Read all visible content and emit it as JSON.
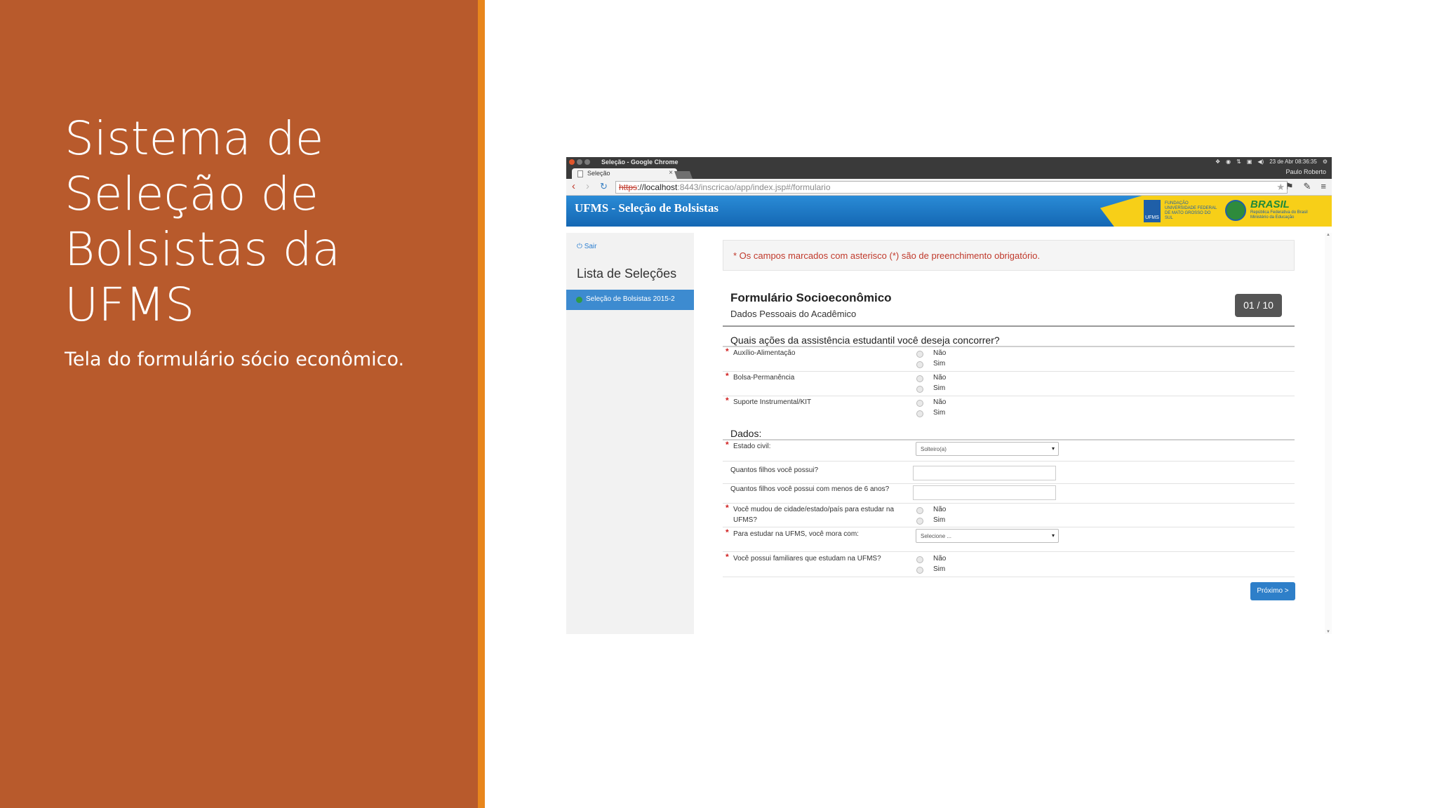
{
  "slide": {
    "title": "Sistema de Seleção de Bolsistas da UFMS",
    "subtitle": "Tela do formulário sócio econômico.",
    "colors": {
      "panel": "#b85a2c",
      "accent_bar": "#e8861c"
    }
  },
  "browser": {
    "window_title": "Seleção - Google Chrome",
    "tab_title": "Seleção",
    "tab_close": "×",
    "clock": "23 de Abr 08:36:35",
    "user": "Paulo Roberto",
    "url_scheme": "https",
    "url_host": "://localhost",
    "url_rest": ":8443/inscricao/app/index.jsp#/formulario",
    "icons": [
      "back-arrow-icon",
      "forward-arrow-icon",
      "reload-icon",
      "bookmark-star-icon",
      "extension-icon",
      "tools-icon",
      "menu-icon"
    ]
  },
  "app": {
    "title": "UFMS - Seleção de Bolsistas",
    "logos": {
      "ufms": "UFMS",
      "fundacao": "FUNDAÇÃO UNIVERSIDADE FEDERAL DE MATO GROSSO DO SUL",
      "brasil": "BRASIL",
      "republica": "República Federativa do Brasil Ministério da Educação"
    },
    "colors": {
      "header_blue": "#1467b3",
      "header_yellow": "#f7cf18"
    }
  },
  "sidebar": {
    "logout": "Sair",
    "list_title": "Lista de Seleções",
    "items": [
      {
        "label": "Seleção de Bolsistas 2015-2",
        "active": true
      }
    ]
  },
  "form": {
    "required_notice": "* Os campos marcados com asterisco (*) são de preenchimento obrigatório.",
    "title": "Formulário Socioeconômico",
    "subtitle": "Dados Pessoais do Acadêmico",
    "step": "01 / 10",
    "section_assistencia": "Quais ações da assistência estudantil você deseja concorrer?",
    "assistencia": [
      {
        "label": "Auxílio-Alimentação",
        "options": [
          "Não",
          "Sim"
        ]
      },
      {
        "label": "Bolsa-Permanência",
        "options": [
          "Não",
          "Sim"
        ]
      },
      {
        "label": "Suporte Instrumental/KIT",
        "options": [
          "Não",
          "Sim"
        ]
      }
    ],
    "section_dados": "Dados:",
    "estado_civil": {
      "label": "Estado civil:",
      "value": "Solteiro(a)"
    },
    "filhos": {
      "label": "Quantos filhos você possui?",
      "value": ""
    },
    "filhos6": {
      "label": "Quantos filhos você possui com menos de 6 anos?",
      "value": ""
    },
    "mudou": {
      "label": "Você mudou de cidade/estado/país para estudar na UFMS?",
      "options": [
        "Não",
        "Sim"
      ]
    },
    "mora": {
      "label": "Para estudar na UFMS, você mora com:",
      "value": "Selecione ..."
    },
    "familiares": {
      "label": "Você possui familiares que estudam na UFMS?",
      "options": [
        "Não",
        "Sim"
      ]
    },
    "next_button": "Próximo >",
    "select_caret": "▾"
  }
}
